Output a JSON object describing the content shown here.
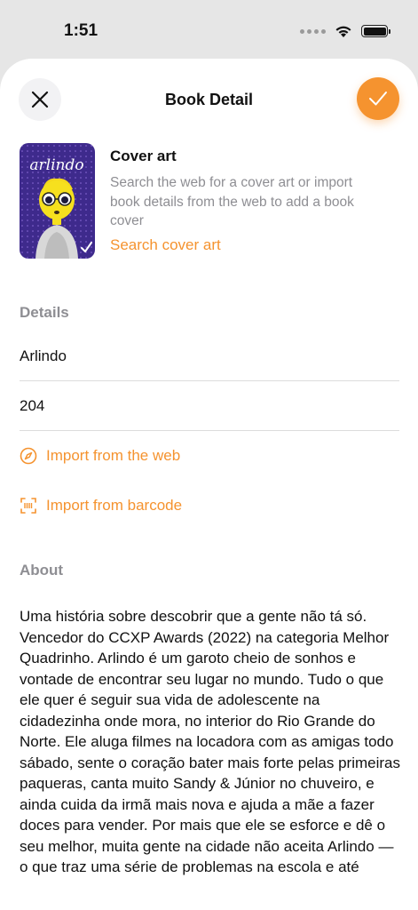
{
  "status_bar": {
    "time": "1:51"
  },
  "nav": {
    "title": "Book Detail"
  },
  "cover": {
    "heading": "Cover art",
    "description": "Search the web for a cover art or import book details from the web to add a book cover",
    "search_link": "Search cover art"
  },
  "details": {
    "section_label": "Details",
    "title_value": "Arlindo",
    "pages_value": "204",
    "import_web_label": "Import from the web",
    "import_barcode_label": "Import from barcode"
  },
  "about": {
    "section_label": "About",
    "text": "Uma história sobre descobrir que a gente não tá só. Vencedor do CCXP Awards (2022) na categoria Melhor Quadrinho. Arlindo é um garoto cheio de sonhos e vontade de encontrar seu lugar no mundo. Tudo o que ele quer é seguir sua vida de adolescente na cidadezinha onde mora, no interior do Rio Grande do Norte. Ele aluga filmes na locadora com as amigas todo sábado, sente o coração bater mais forte pelas primeiras paqueras, canta muito Sandy & Júnior no chuveiro, e ainda cuida da irmã mais nova e ajuda a mãe a fazer doces para vender. Por mais que ele se esforce e dê o seu melhor, muita gente na cidade não aceita Arlindo — o que traz uma série de problemas na escola e até"
  },
  "book_cover_art": {
    "title_lettering": "arlindo"
  },
  "colors": {
    "accent": "#f5932f",
    "secondary_text": "#8e8e93",
    "background": "#e6e6e6",
    "sheet": "#ffffff"
  },
  "icons": {
    "close": "close-icon",
    "confirm": "checkmark-icon",
    "import_web": "compass-icon",
    "import_barcode": "barcode-scan-icon",
    "wifi": "wifi-icon",
    "battery": "battery-icon"
  }
}
